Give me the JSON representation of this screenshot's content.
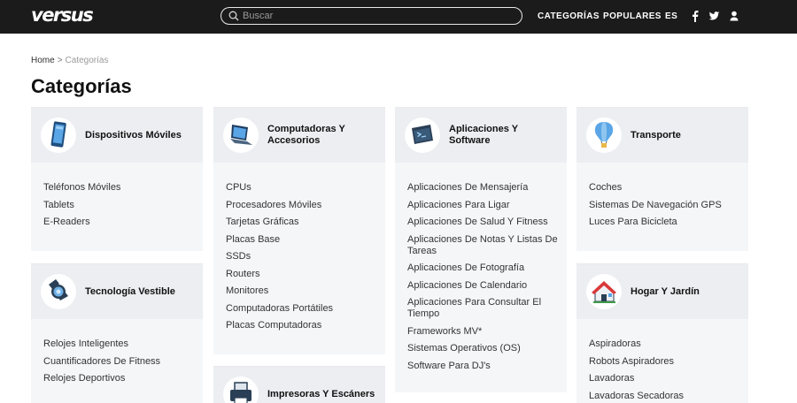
{
  "header": {
    "logo": "versus",
    "search_placeholder": "Buscar",
    "nav": {
      "categories": "CATEGORÍAS",
      "popular": "POPULARES",
      "language": "ES"
    },
    "icons": [
      "facebook-icon",
      "twitter-icon",
      "user-icon"
    ]
  },
  "breadcrumb": {
    "home": "Home",
    "separator": ">",
    "current": "Categorías"
  },
  "page_title": "Categorías",
  "cards": [
    {
      "title": "Dispositivos Móviles",
      "icon": "smartphone-icon",
      "items": [
        "Teléfonos Móviles",
        "Tablets",
        "E-Readers"
      ]
    },
    {
      "title": "Computadoras Y Accesorios",
      "icon": "laptop-icon",
      "items": [
        "CPUs",
        "Procesadores Móviles",
        "Tarjetas Gráficas",
        "Placas Base",
        "SSDs",
        "Routers",
        "Monitores",
        "Computadoras Portátiles",
        "Placas Computadoras"
      ]
    },
    {
      "title": "Aplicaciones Y Software",
      "icon": "terminal-icon",
      "items": [
        "Aplicaciones De Mensajería",
        "Aplicaciones Para Ligar",
        "Aplicaciones De Salud Y Fitness",
        "Aplicaciones De Notas Y Listas De Tareas",
        "Aplicaciones De Fotografía",
        "Aplicaciones De Calendario",
        "Aplicaciones Para Consultar El Tiempo",
        "Frameworks MV*",
        "Sistemas Operativos (OS)",
        "Software Para DJ's"
      ]
    },
    {
      "title": "Transporte",
      "icon": "hot-air-balloon-icon",
      "items": [
        "Coches",
        "Sistemas De Navegación GPS",
        "Luces Para Bicicleta"
      ]
    },
    {
      "title": "Tecnología Vestible",
      "icon": "smartwatch-icon",
      "items": [
        "Relojes Inteligentes",
        "Cuantificadores De Fitness",
        "Relojes Deportivos"
      ]
    },
    {
      "title": "Hogar Y Jardín",
      "icon": "house-icon",
      "items": [
        "Aspiradoras",
        "Robots Aspiradores",
        "Lavadoras",
        "Lavadoras Secadoras"
      ]
    },
    {
      "title": "Impresoras Y Escáners",
      "icon": "printer-icon",
      "items": []
    }
  ],
  "colors": {
    "topbar": "#1b1b1b",
    "card_head": "#eceef2",
    "card_body": "#f5f6f8",
    "icon_blue": "#2d6fa3"
  }
}
